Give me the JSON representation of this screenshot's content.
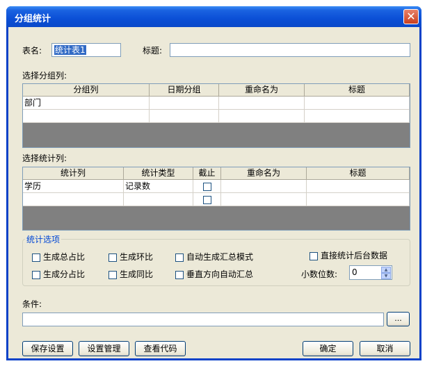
{
  "window": {
    "title": "分组统计"
  },
  "form": {
    "table_name_label": "表名:",
    "table_name_value": "统计表1",
    "caption_label": "标题:",
    "caption_value": ""
  },
  "group_section": {
    "label": "选择分组列:",
    "columns": [
      "分组列",
      "日期分组",
      "重命名为",
      "标题"
    ],
    "rows": [
      [
        "部门",
        "",
        "",
        ""
      ],
      [
        "",
        "",
        "",
        ""
      ]
    ]
  },
  "stat_section": {
    "label": "选择统计列:",
    "columns": [
      "统计列",
      "统计类型",
      "截止",
      "重命名为",
      "标题"
    ],
    "rows": [
      [
        "学历",
        "记录数",
        "",
        "",
        ""
      ],
      [
        "",
        "",
        "",
        "",
        ""
      ]
    ]
  },
  "options": {
    "group_label": "统计选项",
    "total_ratio": "生成总占比",
    "ring_ratio": "生成环比",
    "auto_summary_mode": "自动生成汇总模式",
    "direct_backend": "直接统计后台数据",
    "sub_ratio": "生成分占比",
    "yoy_ratio": "生成同比",
    "vertical_auto_summary": "垂直方向自动汇总",
    "decimal_label": "小数位数:",
    "decimal_value": "0"
  },
  "condition": {
    "label": "条件:",
    "value": "",
    "browse_label": "..."
  },
  "buttons": {
    "save_settings": "保存设置",
    "manage_settings": "设置管理",
    "view_code": "查看代码",
    "ok": "确定",
    "cancel": "取消"
  }
}
